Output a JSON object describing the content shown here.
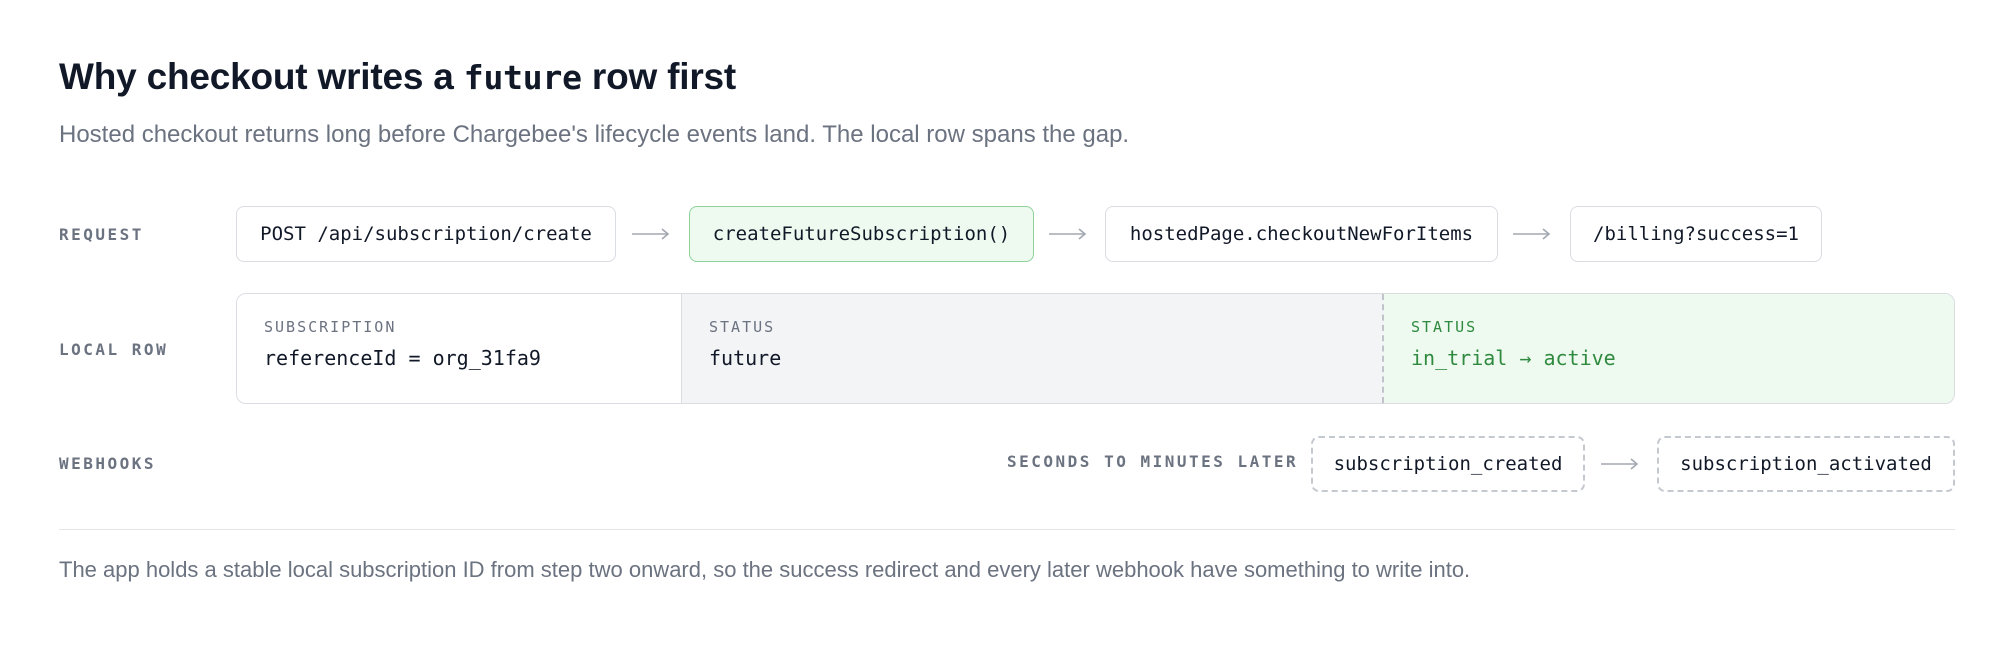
{
  "header": {
    "title_prefix": "Why checkout writes a ",
    "title_code": "future",
    "title_suffix": " row first",
    "subtitle": "Hosted checkout returns long before Chargebee's lifecycle events land. The local row spans the gap."
  },
  "rows": {
    "request": {
      "label": "REQUEST",
      "steps": [
        "POST /api/subscription/create",
        "createFutureSubscription()",
        "hostedPage.checkoutNewForItems",
        "/billing?success=1"
      ]
    },
    "local_row": {
      "label": "LOCAL ROW",
      "segments": [
        {
          "label": "SUBSCRIPTION",
          "value": "referenceId = org_31fa9"
        },
        {
          "label": "STATUS",
          "value": "future"
        },
        {
          "label": "STATUS",
          "value": "in_trial → active"
        }
      ]
    },
    "webhooks": {
      "label": "WEBHOOKS",
      "timing": "SECONDS TO MINUTES LATER",
      "events": [
        "subscription_created",
        "subscription_activated"
      ]
    }
  },
  "footnote": "The app holds a stable local subscription ID from step two onward, so the success redirect and every later webhook have something to write into.",
  "colors": {
    "highlight_bg": "#eefaf0",
    "highlight_border": "#8fd19b",
    "highlight_text": "#2f8a3f",
    "pending_bg": "#f3f4f6"
  },
  "icons": {
    "step_arrow": "arrow-right-icon"
  }
}
